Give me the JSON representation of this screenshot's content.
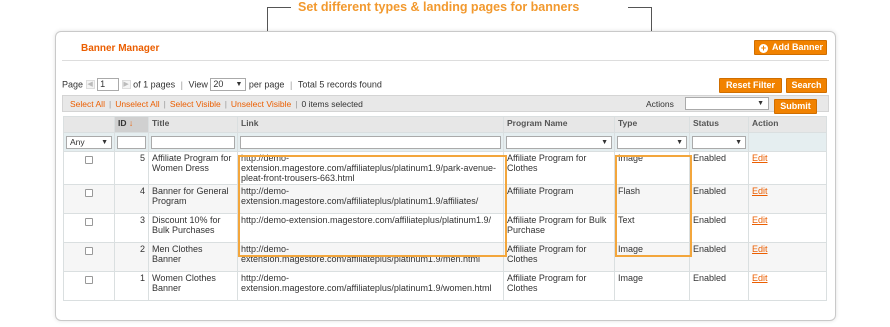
{
  "callout": {
    "text": "Set different types & landing pages for banners"
  },
  "panel": {
    "title": "Banner Manager",
    "add_button": "Add Banner",
    "reset_filter": "Reset Filter",
    "search": "Search"
  },
  "pager": {
    "page_label": "Page",
    "page_value": "1",
    "of_pages": "of 1 pages",
    "view_label": "View",
    "per_page_value": "20",
    "per_page_label": "per page",
    "total": "Total 5 records found"
  },
  "mass": {
    "select_all": "Select All",
    "unselect_all": "Unselect All",
    "select_visible": "Select Visible",
    "unselect_visible": "Unselect Visible",
    "items_selected": "0 items selected",
    "actions_label": "Actions",
    "submit": "Submit"
  },
  "grid": {
    "columns": {
      "id": "ID",
      "title": "Title",
      "link": "Link",
      "program": "Program Name",
      "type": "Type",
      "status": "Status",
      "action": "Action"
    },
    "filter_any": "Any",
    "rows": [
      {
        "id": "5",
        "title": "Affiliate Program for Women Dress",
        "link": "http://demo-extension.magestore.com/affiliateplus/platinum1.9/park-avenue-pleat-front-trousers-663.html",
        "program": "Affiliate Program for Clothes",
        "type": "Image",
        "status": "Enabled",
        "action": "Edit"
      },
      {
        "id": "4",
        "title": "Banner for General Program",
        "link": "http://demo-extension.magestore.com/affiliateplus/platinum1.9/affiliates/",
        "program": "Affiliate Program",
        "type": "Flash",
        "status": "Enabled",
        "action": "Edit"
      },
      {
        "id": "3",
        "title": "Discount 10% for Bulk Purchases",
        "link": "http://demo-extension.magestore.com/affiliateplus/platinum1.9/",
        "program": "Affiliate Program for Bulk Purchase",
        "type": "Text",
        "status": "Enabled",
        "action": "Edit"
      },
      {
        "id": "2",
        "title": "Men Clothes Banner",
        "link": "http://demo-extension.magestore.com/affiliateplus/platinum1.9/men.html",
        "program": "Affiliate Program for Clothes",
        "type": "Image",
        "status": "Enabled",
        "action": "Edit"
      },
      {
        "id": "1",
        "title": "Women Clothes Banner",
        "link": "http://demo-extension.magestore.com/affiliateplus/platinum1.9/women.html",
        "program": "Affiliate Program for Clothes",
        "type": "Image",
        "status": "Enabled",
        "action": "Edit"
      }
    ]
  },
  "colors": {
    "accent": "#f18200",
    "title": "#eb5e00",
    "highlight": "#f3a63c",
    "filter_row": "#e5eef0"
  }
}
